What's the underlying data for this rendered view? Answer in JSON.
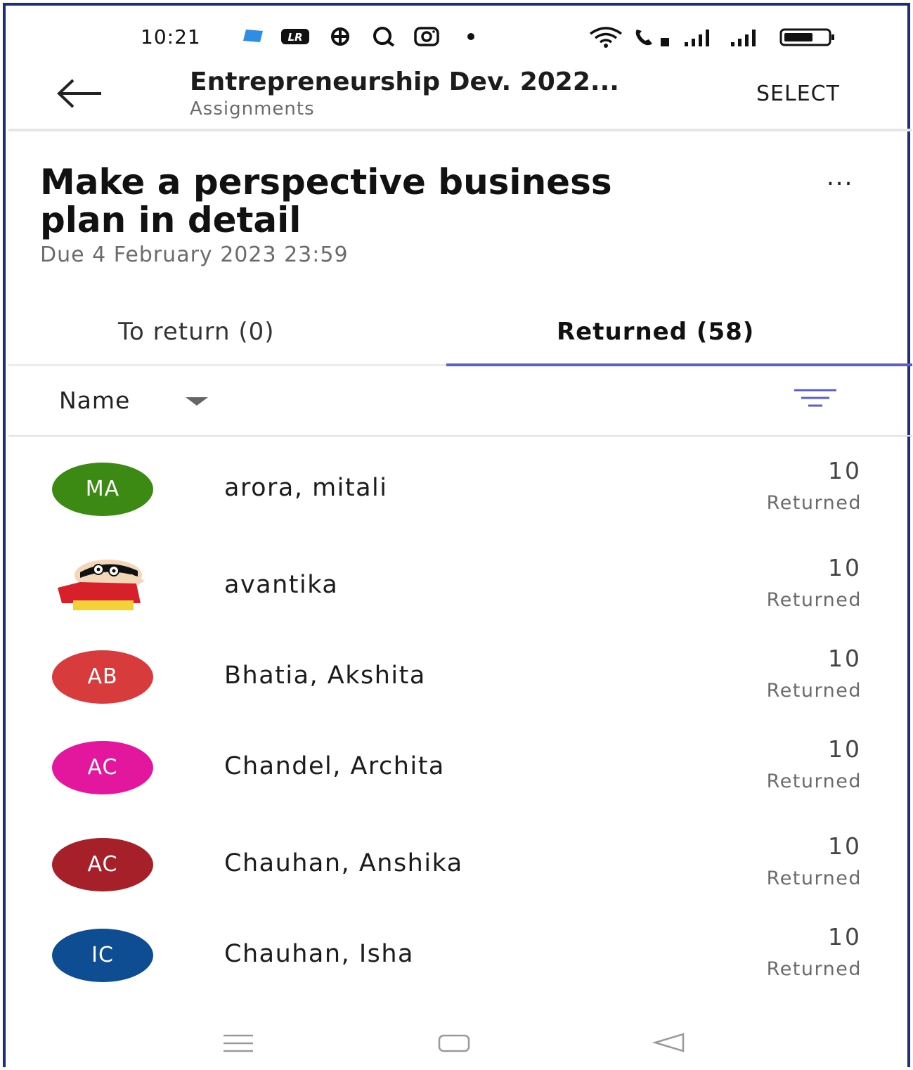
{
  "status_bar": {
    "time": "10:21",
    "icons": [
      "app-icon",
      "lr-icon",
      "settings-icon",
      "search-app-icon",
      "instagram-icon",
      "dot-icon",
      "wifi-icon",
      "call-icon",
      "signal-icon",
      "signal-icon",
      "battery-icon"
    ]
  },
  "header": {
    "title": "Entrepreneurship Dev. 2022...",
    "subtitle": "Assignments",
    "select_label": "SELECT"
  },
  "assignment": {
    "title": "Make a perspective business plan in detail",
    "due": "Due 4 February 2023 23:59",
    "more_label": "..."
  },
  "tabs": [
    {
      "label": "To return (0)",
      "active": false
    },
    {
      "label": "Returned (58)",
      "active": true
    }
  ],
  "sort": {
    "label": "Name"
  },
  "students": [
    {
      "initials": "MA",
      "name": "arora, mitali",
      "score": "10",
      "status": "Returned",
      "color": "#3c8a14",
      "has_photo": false
    },
    {
      "initials": "",
      "name": "avantika",
      "score": "10",
      "status": "Returned",
      "color": "#ffffff",
      "has_photo": true
    },
    {
      "initials": "AB",
      "name": "Bhatia, Akshita",
      "score": "10",
      "status": "Returned",
      "color": "#d83b3b",
      "has_photo": false
    },
    {
      "initials": "AC",
      "name": "Chandel, Archita",
      "score": "10",
      "status": "Returned",
      "color": "#e3169e",
      "has_photo": false
    },
    {
      "initials": "AC",
      "name": "Chauhan, Anshika",
      "score": "10",
      "status": "Returned",
      "color": "#a52029",
      "has_photo": false
    },
    {
      "initials": "IC",
      "name": "Chauhan, Isha",
      "score": "10",
      "status": "Returned",
      "color": "#0f4d92",
      "has_photo": false
    }
  ],
  "colors": {
    "accent": "#5b5fc7",
    "frame": "#1f2e6e"
  }
}
